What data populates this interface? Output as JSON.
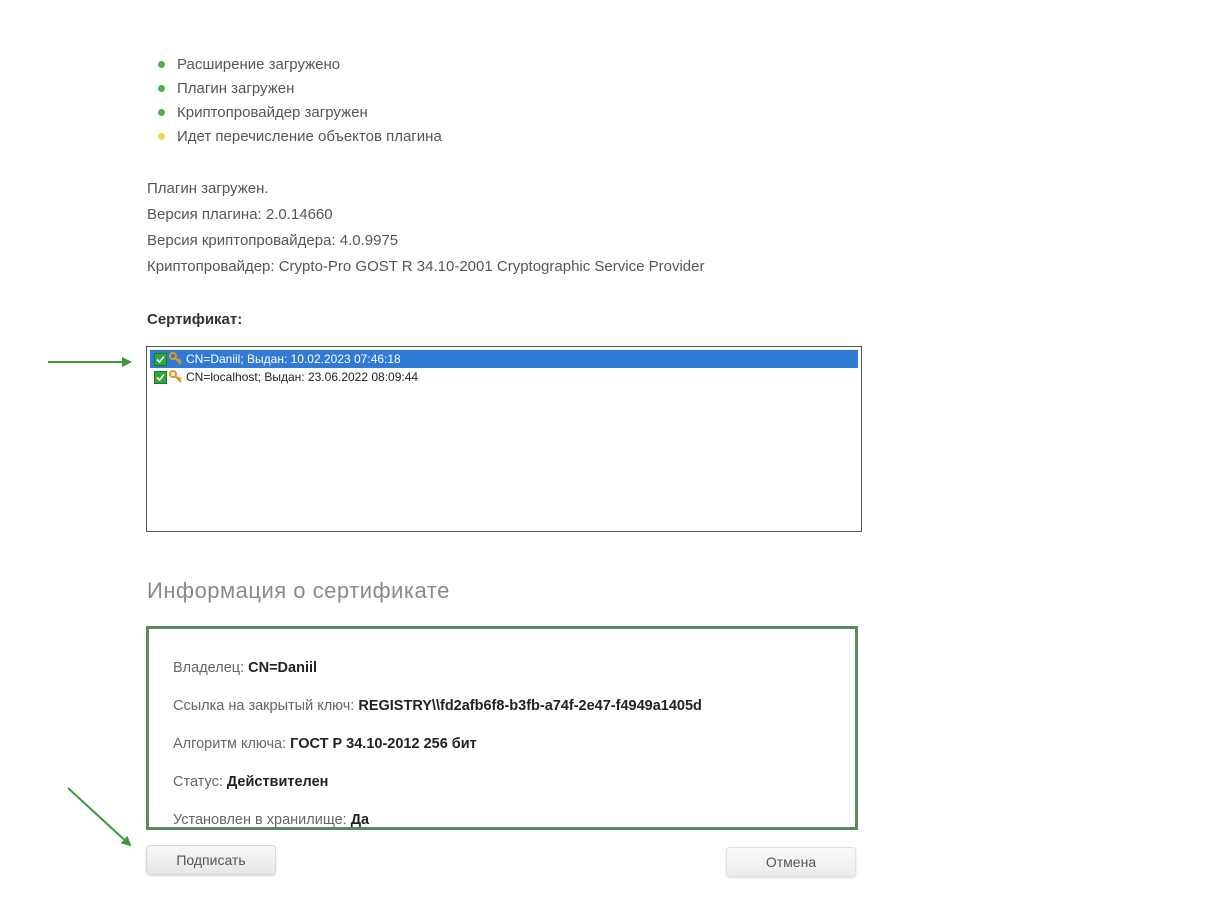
{
  "status_list": [
    {
      "text": "Расширение загружено",
      "color": "#4cae4c"
    },
    {
      "text": "Плагин загружен",
      "color": "#4cae4c"
    },
    {
      "text": "Криптопровайдер загружен",
      "color": "#4cae4c"
    },
    {
      "text": "Идет перечисление объектов плагина",
      "color": "#e8d84a"
    }
  ],
  "plugin_info": {
    "loaded": "Плагин загружен.",
    "plugin_version": "Версия плагина: 2.0.14660",
    "csp_version": "Версия криптопровайдера: 4.0.9975",
    "csp_name": "Криптопровайдер: Crypto-Pro GOST R 34.10-2001 Cryptographic Service Provider"
  },
  "certificate": {
    "label": "Сертификат:",
    "items": [
      {
        "text": "CN=Daniil; Выдан: 10.02.2023 07:46:18",
        "selected": true
      },
      {
        "text": "CN=localhost; Выдан: 23.06.2022 08:09:44",
        "selected": false
      }
    ]
  },
  "cert_info": {
    "heading": "Информация о сертификате",
    "owner_label": "Владелец:",
    "owner_value": "CN=Daniil",
    "key_link_label": "Ссылка на закрытый ключ:",
    "key_link_value": "REGISTRY\\\\fd2afb6f8-b3fb-a74f-2e47-f4949a1405d",
    "algorithm_label": "Алгоритм ключа:",
    "algorithm_value": "ГОСТ Р 34.10-2012 256 бит",
    "status_label": "Статус:",
    "status_value": "Действителен",
    "store_label": "Установлен в хранилище:",
    "store_value": "Да"
  },
  "buttons": {
    "sign": "Подписать",
    "cancel": "Отмена"
  },
  "colors": {
    "ok": "#4cae4c",
    "pending": "#e8d84a",
    "selection": "#2f7bd6",
    "info_border": "#5a8a5a",
    "annotation_arrow": "#3a9a3a"
  }
}
